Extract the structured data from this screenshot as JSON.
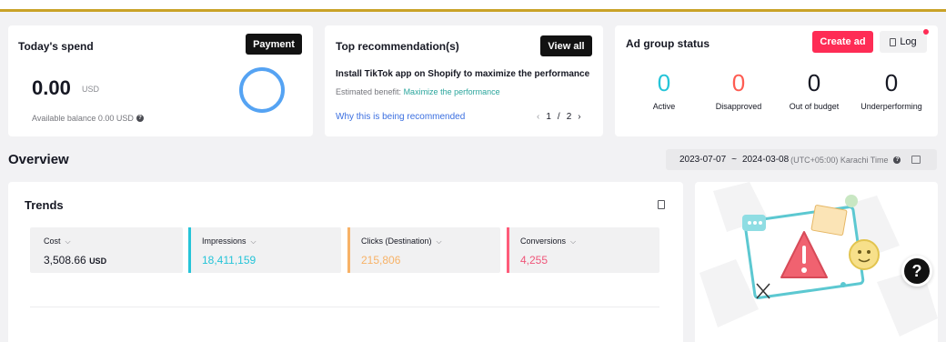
{
  "spend": {
    "title": "Today's spend",
    "payment_label": "Payment",
    "value": "0.00",
    "unit": "USD",
    "balance": "Available balance 0.00 USD"
  },
  "recommendation": {
    "title": "Top recommendation(s)",
    "view_all_label": "View all",
    "text": "Install TikTok app on Shopify to maximize the performance",
    "benefit_label": "Estimated benefit:",
    "benefit_value": "Maximize the performance",
    "why_link": "Why this is being recommended",
    "page_current": "1",
    "page_sep": "/",
    "page_total": "2"
  },
  "ad_group": {
    "title": "Ad group status",
    "create_label": "Create ad",
    "log_label": "Log",
    "statuses": [
      {
        "value": "0",
        "label": "Active",
        "color": "#25c4d8"
      },
      {
        "value": "0",
        "label": "Disapproved",
        "color": "#fe5c52"
      },
      {
        "value": "0",
        "label": "Out of budget",
        "color": "#161823"
      },
      {
        "value": "0",
        "label": "Underperforming",
        "color": "#161823"
      }
    ]
  },
  "overview": {
    "title": "Overview",
    "date_start": "2023-07-07",
    "date_sep": "~",
    "date_end": "2024-03-08",
    "timezone": "(UTC+05:00) Karachi Time"
  },
  "trends": {
    "title": "Trends",
    "metrics": [
      {
        "label": "Cost",
        "value": "3,508.66",
        "unit": "USD",
        "color": "#e5e5e7",
        "value_color": "#161823"
      },
      {
        "label": "Impressions",
        "value": "18,411,159",
        "unit": "",
        "color": "#25c4d8",
        "value_color": "#25c4d8"
      },
      {
        "label": "Clicks (Destination)",
        "value": "215,806",
        "unit": "",
        "color": "#f7b267",
        "value_color": "#f7b267"
      },
      {
        "label": "Conversions",
        "value": "4,255",
        "unit": "",
        "color": "#fe5c7a",
        "value_color": "#f0567a"
      }
    ]
  },
  "help": {
    "label": "?"
  }
}
